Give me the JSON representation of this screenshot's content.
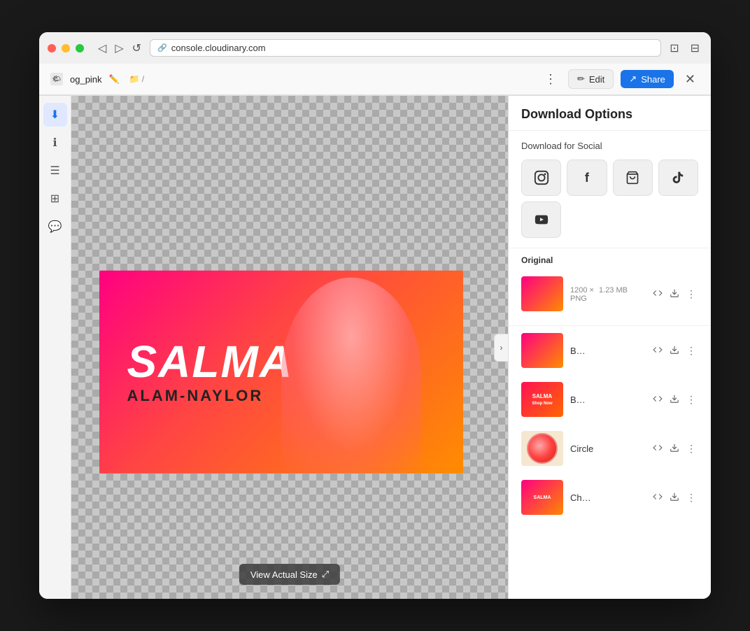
{
  "browser": {
    "url": "console.cloudinary.com",
    "tab_title": "og_pink",
    "breadcrumb": "/"
  },
  "toolbar": {
    "more_label": "⋮",
    "edit_label": "Edit",
    "share_label": "Share",
    "close_label": "✕"
  },
  "sidebar": {
    "icons": [
      "⬇",
      "ℹ",
      "☰",
      "⊞",
      "💬"
    ]
  },
  "canvas": {
    "view_size_label": "View Actual Size"
  },
  "panel": {
    "title": "Download Options",
    "social_section_title": "Download for Social",
    "social_buttons": [
      {
        "label": "Instagram",
        "icon": "📷"
      },
      {
        "label": "Facebook",
        "icon": "f"
      },
      {
        "label": "Shopify",
        "icon": "🛍"
      },
      {
        "label": "TikTok",
        "icon": "♪"
      },
      {
        "label": "YouTube",
        "icon": "▶"
      }
    ],
    "original": {
      "label": "Original",
      "dimensions": "1200 × ",
      "size": "1.23 MB",
      "format": "PNG"
    },
    "download_items": [
      {
        "id": "original",
        "label": "Original",
        "dimensions": "1200 ×",
        "size": "1.23 MB",
        "format": "PNG",
        "thumb_type": "original"
      },
      {
        "id": "b1",
        "label": "B…",
        "thumb_type": "small"
      },
      {
        "id": "b2",
        "label": "B…",
        "thumb_type": "social"
      },
      {
        "id": "circle",
        "label": "Circle",
        "thumb_type": "circle"
      },
      {
        "id": "b3",
        "label": "Ch…",
        "thumb_type": "bottom"
      }
    ]
  },
  "colors": {
    "accent_blue": "#1a73e8",
    "brand_pink": "#ff0080",
    "brand_orange": "#ff8c00"
  }
}
